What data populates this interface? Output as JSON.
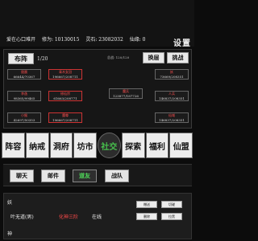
{
  "status": {
    "user": "爱在心口难开",
    "cultivation": "修为: 10130015",
    "spirit_stones": "灵石: 23082032",
    "immortal_value": "仙缘: 0"
  },
  "settings_label": "设置",
  "formation": {
    "title": "布阵",
    "count": "1/20",
    "swap": "换层",
    "challenge": "挑战",
    "power_label": "总战: 120/120",
    "left_cards": [
      {
        "name": "聂晨",
        "hp": "66644/70367"
      },
      {
        "name": "李逸",
        "hp": "98365/99465"
      },
      {
        "name": "小猴",
        "hp": "42697/50353"
      }
    ],
    "middle_cards": [
      {
        "name": "青木女冠",
        "hp": "196667/208711"
      },
      {
        "name": "修仙宗",
        "hp": "61663/208771"
      },
      {
        "name": "魔尊",
        "hp": "196667/208711"
      }
    ],
    "enemy": {
      "name": "魔兵",
      "hp": "123877/187726"
    },
    "right_cards": [
      {
        "name": "妖",
        "hp": "73669/208351"
      },
      {
        "name": "人兵",
        "hp": "146837/208351"
      },
      {
        "name": "仙域",
        "hp": "146837/208351"
      }
    ]
  },
  "nav": [
    "阵容",
    "纳戒",
    "洞府",
    "坊市",
    "社交",
    "探索",
    "福利",
    "仙盟"
  ],
  "chat_tabs": [
    "聊天",
    "邮件",
    "道友",
    "战队"
  ],
  "friends": {
    "section1": "妖",
    "entry": {
      "name": "叶无道(男)",
      "tag": "化神三阶",
      "state": "在线"
    },
    "actions": [
      "赠送",
      "切磋",
      "删除",
      "拉黑"
    ],
    "section2": "神"
  },
  "colors": {
    "accent_green": "#47c14d",
    "danger_red": "#ff4a4a"
  }
}
